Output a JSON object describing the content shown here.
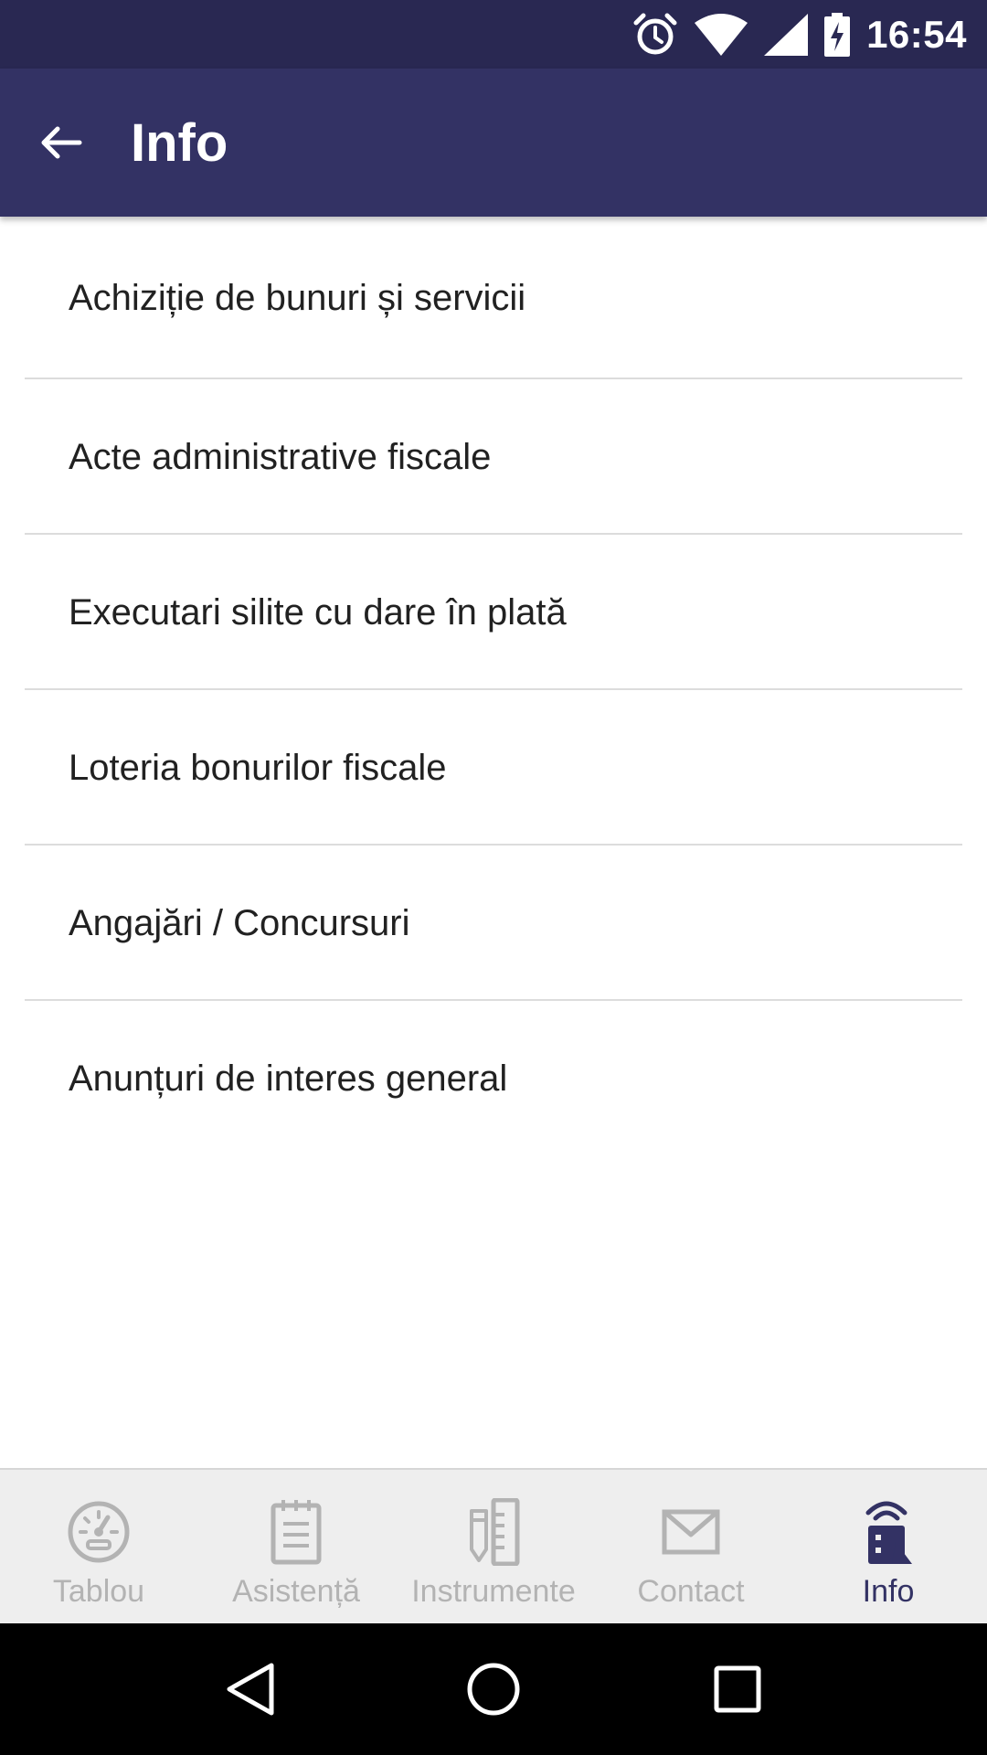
{
  "status_bar": {
    "time": "16:54",
    "icons": [
      "alarm-icon",
      "wifi-icon",
      "cell-signal-icon",
      "battery-charging-icon"
    ]
  },
  "app_bar": {
    "title": "Info",
    "back_icon": "arrow-back-icon"
  },
  "list": {
    "items": [
      {
        "label": "Achiziție de bunuri și servicii"
      },
      {
        "label": "Acte administrative fiscale"
      },
      {
        "label": "Executari silite cu dare în plată"
      },
      {
        "label": "Loteria bonurilor fiscale"
      },
      {
        "label": "Angajări / Concursuri"
      },
      {
        "label": "Anunțuri de interes general"
      }
    ]
  },
  "bottom_nav": {
    "items": [
      {
        "label": "Tablou",
        "icon": "dashboard-icon",
        "active": false
      },
      {
        "label": "Asistență",
        "icon": "notepad-icon",
        "active": false
      },
      {
        "label": "Instrumente",
        "icon": "tools-icon",
        "active": false
      },
      {
        "label": "Contact",
        "icon": "mail-icon",
        "active": false
      },
      {
        "label": "Info",
        "icon": "info-building-icon",
        "active": true
      }
    ]
  },
  "colors": {
    "status_bar": "#292852",
    "app_bar": "#333264",
    "active_nav": "#333264",
    "inactive_nav": "#b3b3b3"
  }
}
